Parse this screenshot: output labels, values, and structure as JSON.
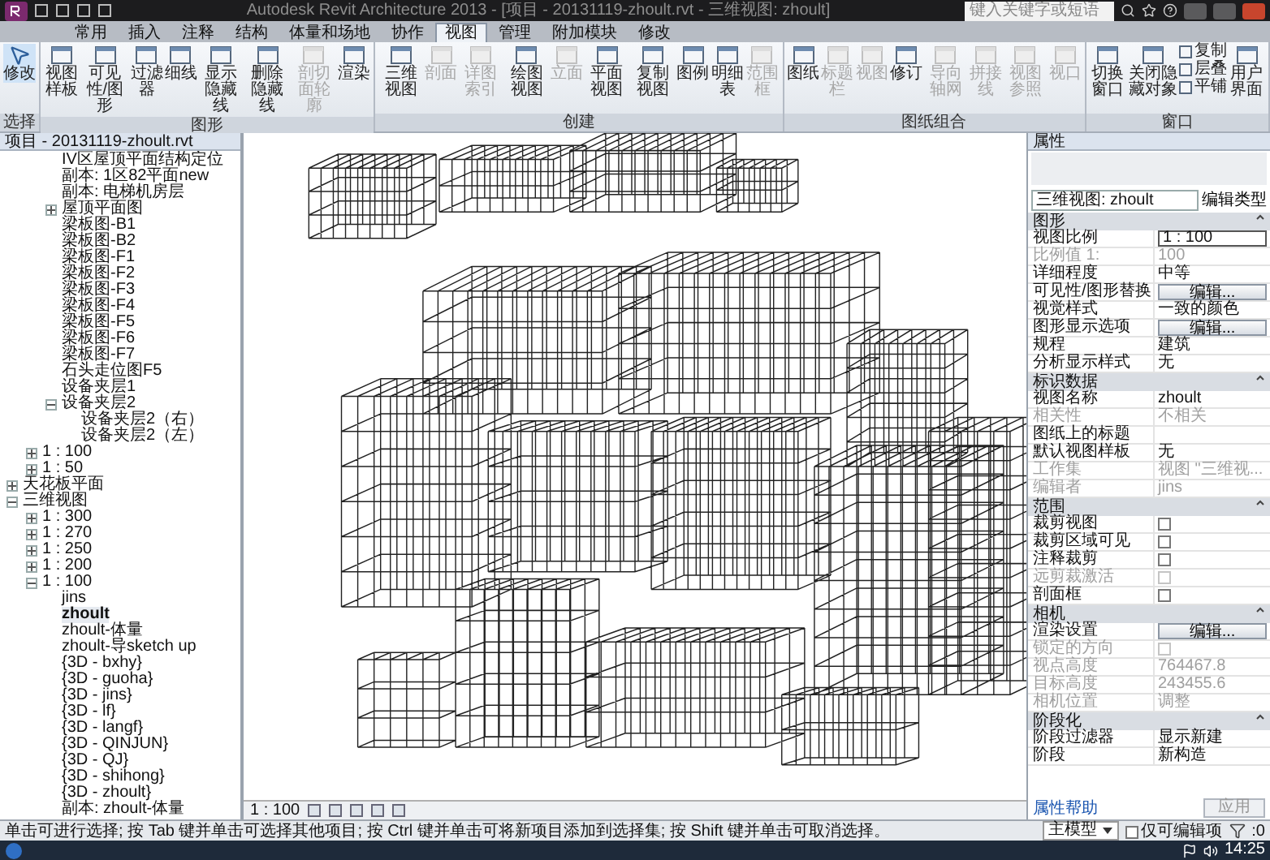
{
  "window": {
    "title": "Autodesk Revit Architecture 2013 - [项目 - 20131119-zhoult.rvt - 三维视图: zhoult]",
    "search": {
      "placeholder": "键入关键字或短语"
    }
  },
  "ribbon_tabs": [
    {
      "label": "常用",
      "selected": false
    },
    {
      "label": "插入",
      "selected": false
    },
    {
      "label": "注释",
      "selected": false
    },
    {
      "label": "结构",
      "selected": false
    },
    {
      "label": "体量和场地",
      "selected": false
    },
    {
      "label": "协作",
      "selected": false
    },
    {
      "label": "视图",
      "selected": true
    },
    {
      "label": "管理",
      "selected": false
    },
    {
      "label": "附加模块",
      "selected": false
    },
    {
      "label": "修改",
      "selected": false
    }
  ],
  "ribbon_panels": [
    {
      "title": "选择",
      "tools": [
        {
          "label": "修改",
          "kind": "select",
          "disabled": false
        }
      ]
    },
    {
      "title": "图形",
      "tools": [
        {
          "label": "视图样板",
          "kind": "large",
          "disabled": false
        },
        {
          "label": "可见性/图形",
          "kind": "large",
          "disabled": false
        },
        {
          "label": "过滤器",
          "kind": "large",
          "disabled": false
        },
        {
          "label": "细线",
          "kind": "large",
          "disabled": false
        },
        {
          "label": "显示隐藏线",
          "kind": "large",
          "disabled": false
        },
        {
          "label": "删除隐藏线",
          "kind": "large",
          "disabled": false
        },
        {
          "label": "剖切面轮廓",
          "kind": "large",
          "disabled": true
        },
        {
          "label": "渲染",
          "kind": "large",
          "disabled": false
        }
      ]
    },
    {
      "title": "创建",
      "tools": [
        {
          "label": "三维视图",
          "kind": "large",
          "disabled": false
        },
        {
          "label": "剖面",
          "kind": "large",
          "disabled": true
        },
        {
          "label": "详图索引",
          "kind": "large",
          "disabled": true
        },
        {
          "label": "绘图视图",
          "kind": "large",
          "disabled": false
        },
        {
          "label": "立面",
          "kind": "large",
          "disabled": true
        },
        {
          "label": "平面视图",
          "kind": "large",
          "disabled": false
        },
        {
          "label": "复制视图",
          "kind": "large",
          "disabled": false
        },
        {
          "label": "图例",
          "kind": "large",
          "disabled": false
        },
        {
          "label": "明细表",
          "kind": "large",
          "disabled": false
        },
        {
          "label": "范围框",
          "kind": "large",
          "disabled": true
        }
      ]
    },
    {
      "title": "图纸组合",
      "tools": [
        {
          "label": "图纸",
          "kind": "large",
          "disabled": false
        },
        {
          "label": "标题栏",
          "kind": "large",
          "disabled": true
        },
        {
          "label": "视图",
          "kind": "large",
          "disabled": true
        },
        {
          "label": "修订",
          "kind": "large",
          "disabled": false
        },
        {
          "label": "导向轴网",
          "kind": "large",
          "disabled": true
        },
        {
          "label": "拼接线",
          "kind": "large",
          "disabled": true
        },
        {
          "label": "视图参照",
          "kind": "large",
          "disabled": true
        },
        {
          "label": "视口",
          "kind": "large",
          "disabled": true
        }
      ]
    },
    {
      "title": "窗口",
      "tools": [
        {
          "label": "切换窗口",
          "kind": "large",
          "disabled": false
        },
        {
          "label": "关闭隐藏对象",
          "kind": "large",
          "disabled": false
        },
        {
          "label": "复制",
          "kind": "small",
          "disabled": false
        },
        {
          "label": "层叠",
          "kind": "small",
          "disabled": false
        },
        {
          "label": "平铺",
          "kind": "small",
          "disabled": false
        },
        {
          "label": "用户界面",
          "kind": "large",
          "disabled": false
        }
      ]
    }
  ],
  "project_browser": {
    "title": "项目 - 20131119-zhoult.rvt",
    "tree": [
      {
        "children": [
          {
            "children": [
              {
                "label": "IV区屋顶平面结构定位",
                "selected": false
              },
              {
                "label": "副本: 1区82平面new",
                "selected": false
              },
              {
                "label": "副本: 电梯机房层",
                "selected": false
              },
              {
                "label": "屋顶平面图",
                "selected": false,
                "expanded": false
              },
              {
                "label": "梁板图-B1",
                "selected": false
              },
              {
                "label": "梁板图-B2",
                "selected": false
              },
              {
                "label": "梁板图-F1",
                "selected": false
              },
              {
                "label": "梁板图-F2",
                "selected": false
              },
              {
                "label": "梁板图-F3",
                "selected": false
              },
              {
                "label": "梁板图-F4",
                "selected": false
              },
              {
                "label": "梁板图-F5",
                "selected": false
              },
              {
                "label": "梁板图-F6",
                "selected": false
              },
              {
                "label": "梁板图-F7",
                "selected": false
              },
              {
                "label": "石头走位图F5",
                "selected": false
              },
              {
                "label": "设备夹层1",
                "selected": false
              },
              {
                "label": "设备夹层2",
                "selected": false,
                "expanded": true,
                "children": [
                  {
                    "label": "设备夹层2（右）",
                    "selected": false
                  },
                  {
                    "label": "设备夹层2（左）",
                    "selected": false
                  }
                ]
              }
            ]
          },
          {
            "label": "1 : 100",
            "selected": false,
            "expanded": false
          },
          {
            "label": "1 : 50",
            "selected": false,
            "expanded": false
          }
        ]
      },
      {
        "label": "天花板平面",
        "selected": false,
        "expanded": false
      },
      {
        "label": "三维视图",
        "selected": false,
        "expanded": true,
        "children": [
          {
            "label": "1 : 300",
            "selected": false,
            "expanded": false
          },
          {
            "label": "1 : 270",
            "selected": false,
            "expanded": false
          },
          {
            "label": "1 : 250",
            "selected": false,
            "expanded": false
          },
          {
            "label": "1 : 200",
            "selected": false,
            "expanded": false
          },
          {
            "label": "1 : 100",
            "selected": false,
            "expanded": true,
            "children": [
              {
                "label": "jins",
                "selected": false
              },
              {
                "label": "zhoult",
                "selected": true
              },
              {
                "label": "zhoult-体量",
                "selected": false
              },
              {
                "label": "zhoult-导sketch up",
                "selected": false
              },
              {
                "label": "{3D - bxhy}",
                "selected": false
              },
              {
                "label": "{3D - guoha}",
                "selected": false
              },
              {
                "label": "{3D - jins}",
                "selected": false
              },
              {
                "label": "{3D - lf}",
                "selected": false
              },
              {
                "label": "{3D - langf}",
                "selected": false
              },
              {
                "label": "{3D - QINJUN}",
                "selected": false
              },
              {
                "label": "{3D - QJ}",
                "selected": false
              },
              {
                "label": "{3D - shihong}",
                "selected": false
              },
              {
                "label": "{3D - zhoult}",
                "selected": false
              },
              {
                "label": "副本: zhoult-体量",
                "selected": false
              }
            ]
          }
        ]
      }
    ]
  },
  "view_bar": {
    "scale": "1 : 100"
  },
  "properties": {
    "title": "属性",
    "type_selector": "三维视图: zhoult",
    "edit_type": "编辑类型",
    "groups": [
      {
        "title": "图形",
        "expanded": true,
        "rows": [
          {
            "label": "视图比例",
            "kind": "field",
            "value": "1 : 100",
            "disabled": false
          },
          {
            "label": "比例值 1:",
            "kind": "text",
            "value": "100",
            "disabled": true
          },
          {
            "label": "详细程度",
            "kind": "text",
            "value": "中等",
            "disabled": false
          },
          {
            "label": "可见性/图形替换",
            "kind": "button",
            "value": "编辑...",
            "disabled": false
          },
          {
            "label": "视觉样式",
            "kind": "text",
            "value": "一致的颜色",
            "disabled": false
          },
          {
            "label": "图形显示选项",
            "kind": "button",
            "value": "编辑...",
            "disabled": false
          },
          {
            "label": "规程",
            "kind": "text",
            "value": "建筑",
            "disabled": false
          },
          {
            "label": "分析显示样式",
            "kind": "text",
            "value": "无",
            "disabled": false
          }
        ]
      },
      {
        "title": "标识数据",
        "expanded": true,
        "rows": [
          {
            "label": "视图名称",
            "kind": "text",
            "value": "zhoult",
            "disabled": false
          },
          {
            "label": "相关性",
            "kind": "text",
            "value": "不相关",
            "disabled": true
          },
          {
            "label": "图纸上的标题",
            "kind": "text",
            "disabled": false
          },
          {
            "label": "默认视图样板",
            "kind": "text",
            "value": "无",
            "disabled": false
          },
          {
            "label": "工作集",
            "kind": "text",
            "value": "视图 \"三维视...",
            "disabled": true
          },
          {
            "label": "编辑者",
            "kind": "text",
            "value": "jins",
            "disabled": true
          }
        ]
      },
      {
        "title": "范围",
        "expanded": true,
        "rows": [
          {
            "label": "裁剪视图",
            "kind": "checkbox",
            "checked": false,
            "disabled": false
          },
          {
            "label": "裁剪区域可见",
            "kind": "checkbox",
            "checked": false,
            "disabled": false
          },
          {
            "label": "注释裁剪",
            "kind": "checkbox",
            "checked": false,
            "disabled": false
          },
          {
            "label": "远剪裁激活",
            "kind": "checkbox",
            "checked": false,
            "disabled": true
          },
          {
            "label": "剖面框",
            "kind": "checkbox",
            "checked": false,
            "disabled": false
          }
        ]
      },
      {
        "title": "相机",
        "expanded": true,
        "rows": [
          {
            "label": "渲染设置",
            "kind": "button",
            "value": "编辑...",
            "disabled": false
          },
          {
            "label": "锁定的方向",
            "kind": "checkbox",
            "checked": false,
            "disabled": true
          },
          {
            "label": "视点高度",
            "kind": "text",
            "value": "764467.8",
            "disabled": true
          },
          {
            "label": "目标高度",
            "kind": "text",
            "value": "243455.6",
            "disabled": true
          },
          {
            "label": "相机位置",
            "kind": "text",
            "value": "调整",
            "disabled": true
          }
        ]
      },
      {
        "title": "阶段化",
        "expanded": true,
        "rows": [
          {
            "label": "阶段过滤器",
            "kind": "text",
            "value": "显示新建",
            "disabled": false
          },
          {
            "label": "阶段",
            "kind": "text",
            "value": "新构造",
            "disabled": false
          }
        ]
      }
    ],
    "help_link": "属性帮助",
    "apply_button": "应用"
  },
  "status_bar": {
    "message": "单击可进行选择; 按 Tab 键并单击可选择其他项目; 按 Ctrl 键并单击可将新项目添加到选择集; 按 Shift 键并单击可取消选择。",
    "workset": "主模型",
    "editable_only": {
      "label": "仅可编辑项",
      "checked": false
    },
    "filter_count": ":0"
  },
  "taskbar": {
    "time": "14:25"
  }
}
